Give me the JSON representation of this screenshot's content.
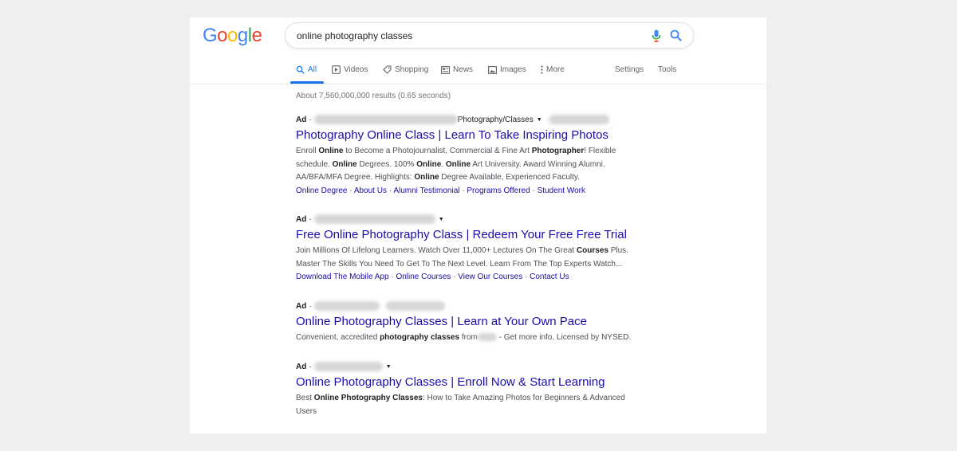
{
  "logo": {
    "letters": [
      "G",
      "o",
      "o",
      "g",
      "l",
      "e"
    ],
    "colors": [
      "#4285f4",
      "#ea4335",
      "#fbbc05",
      "#4285f4",
      "#34a853",
      "#ea4335"
    ]
  },
  "search": {
    "query": "online photography classes"
  },
  "tabs": [
    {
      "label": "All",
      "icon": "search-icon",
      "active": true
    },
    {
      "label": "Videos",
      "icon": "video-icon"
    },
    {
      "label": "Shopping",
      "icon": "tag-icon"
    },
    {
      "label": "News",
      "icon": "newspaper-icon"
    },
    {
      "label": "Images",
      "icon": "image-icon"
    },
    {
      "label": "More",
      "icon": "more-vert-icon"
    }
  ],
  "tools": {
    "settings": "Settings",
    "tools": "Tools"
  },
  "stats": "About 7,560,000,000 results (0.65 seconds)",
  "ads": [
    {
      "label": "Ad",
      "url_suffix": "Photography/Classes",
      "title": "Photography Online Class | Learn To Take Inspiring Photos",
      "description": [
        {
          "t": "Enroll ",
          "b": false
        },
        {
          "t": "Online",
          "b": true
        },
        {
          "t": " to Become a Photojournalist, Commercial & Fine Art ",
          "b": false
        },
        {
          "t": "Photographer",
          "b": true
        },
        {
          "t": "! Flexible schedule. ",
          "b": false
        },
        {
          "t": "Online",
          "b": true
        },
        {
          "t": " Degrees. 100% ",
          "b": false
        },
        {
          "t": "Online",
          "b": true
        },
        {
          "t": ". ",
          "b": false
        },
        {
          "t": "Online",
          "b": true
        },
        {
          "t": " Art University. Award Winning Alumni. AA/BFA/MFA Degree. Highlights: ",
          "b": false
        },
        {
          "t": "Online",
          "b": true
        },
        {
          "t": " Degree Available, Experienced Faculty.",
          "b": false
        }
      ],
      "sitelinks": [
        "Online Degree",
        "About Us",
        "Alumni Testimonial",
        "Programs Offered",
        "Student Work"
      ]
    },
    {
      "label": "Ad",
      "url_suffix": "",
      "title": "Free Online Photography Class | Redeem Your Free Free Trial",
      "description": [
        {
          "t": "Join Millions Of Lifelong Learners. Watch Over 11,000+ Lectures On The Great ",
          "b": false
        },
        {
          "t": "Courses",
          "b": true
        },
        {
          "t": " Plus. Master The Skills You Need To Get To The Next Level. Learn From The Top Experts Watch...",
          "b": false
        }
      ],
      "sitelinks": [
        "Download The Mobile App",
        "Online Courses",
        "View Our Courses",
        "Contact Us"
      ]
    },
    {
      "label": "Ad",
      "url_suffix": "",
      "title": "Online Photography Classes | Learn at Your Own Pace",
      "description": [
        {
          "t": "Convenient, accredited ",
          "b": false
        },
        {
          "t": "photography classes",
          "b": true
        },
        {
          "t": " from",
          "b": false
        },
        {
          "t": "",
          "b": false,
          "blur": true
        },
        {
          "t": " - Get more info. Licensed by NYSED.",
          "b": false
        }
      ],
      "sitelinks": []
    },
    {
      "label": "Ad",
      "url_suffix": "",
      "title": "Online Photography Classes | Enroll Now & Start Learning",
      "description": [
        {
          "t": "Best ",
          "b": false
        },
        {
          "t": "Online Photography Classes",
          "b": true
        },
        {
          "t": ": How to Take Amazing Photos for Beginners & Advanced Users",
          "b": false
        }
      ],
      "sitelinks": []
    }
  ]
}
